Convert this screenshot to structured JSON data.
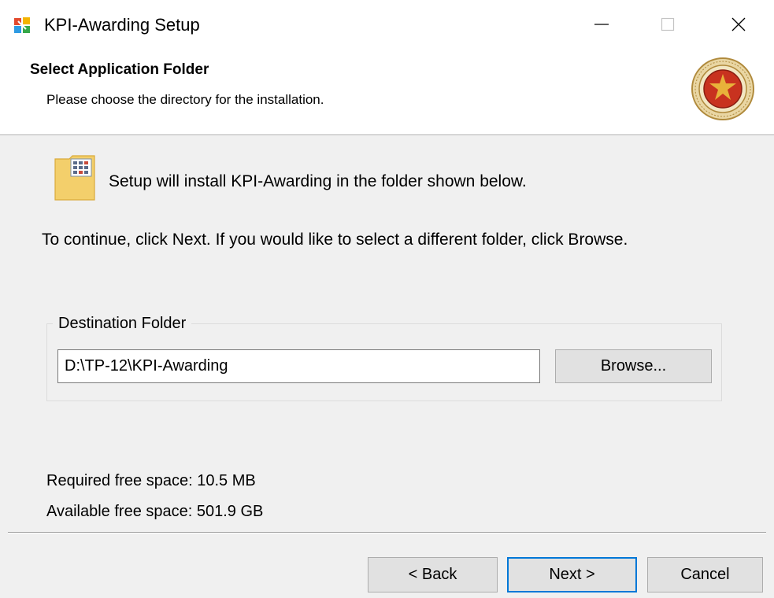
{
  "window": {
    "title": "KPI-Awarding Setup"
  },
  "header": {
    "title": "Select Application Folder",
    "subtitle": "Please choose the directory for the installation."
  },
  "body": {
    "intro": "Setup will install KPI-Awarding in the folder shown below.",
    "instructions": "To continue, click Next. If you would like to select a different folder, click Browse."
  },
  "destination": {
    "group_label": "Destination Folder",
    "path_value": "D:\\TP-12\\KPI-Awarding",
    "browse_label": "Browse..."
  },
  "space": {
    "required": "Required free space: 10.5 MB",
    "available": "Available free space: 501.9 GB"
  },
  "buttons": {
    "back": "< Back",
    "next": "Next >",
    "cancel": "Cancel"
  },
  "colors": {
    "window_bg": "#f0f0f0",
    "header_bg": "#ffffff",
    "focus_border": "#0078d7",
    "button_bg": "#e1e1e1"
  },
  "icons": {
    "app": "installer-app-icon",
    "logo": "university-seal-logo",
    "folder": "folder-icon"
  }
}
